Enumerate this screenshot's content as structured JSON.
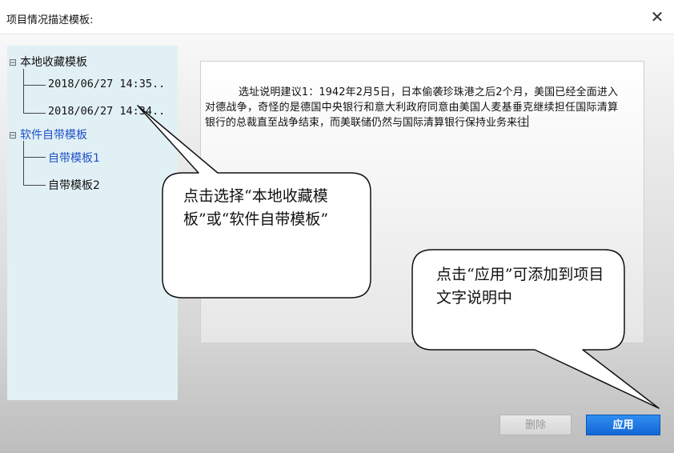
{
  "window": {
    "title": "项目情况描述模板:",
    "close_glyph": "✕"
  },
  "tree": {
    "groups": [
      {
        "toggle": "⊟",
        "label": "本地收藏模板",
        "items": [
          "2018/06/27 14:35..",
          "2018/06/27 14:34.."
        ]
      },
      {
        "toggle": "⊟",
        "label": "软件自带模板",
        "items": [
          "自带模板1",
          "自带模板2"
        ]
      }
    ]
  },
  "editor": {
    "text": "选址说明建议1：1942年2月5日，日本偷袭珍珠港之后2个月，美国已经全面进入对德战争，奇怪的是德国中央银行和意大利政府同意由美国人麦基垂克继续担任国际清算银行的总裁直至战争结束，而美联储仍然与国际清算银行保持业务来往"
  },
  "buttons": {
    "delete_label": "删除",
    "apply_label": "应用"
  },
  "callouts": {
    "select_tip": "点击选择“本地收藏模板”或“软件自带模板”",
    "apply_tip": "点击“应用”可添加到项目文字说明中"
  },
  "colors": {
    "tree_bg": "#e1f0f5",
    "tree_blue_text": "#1f4fc8",
    "apply_button": "#1a73e0"
  }
}
